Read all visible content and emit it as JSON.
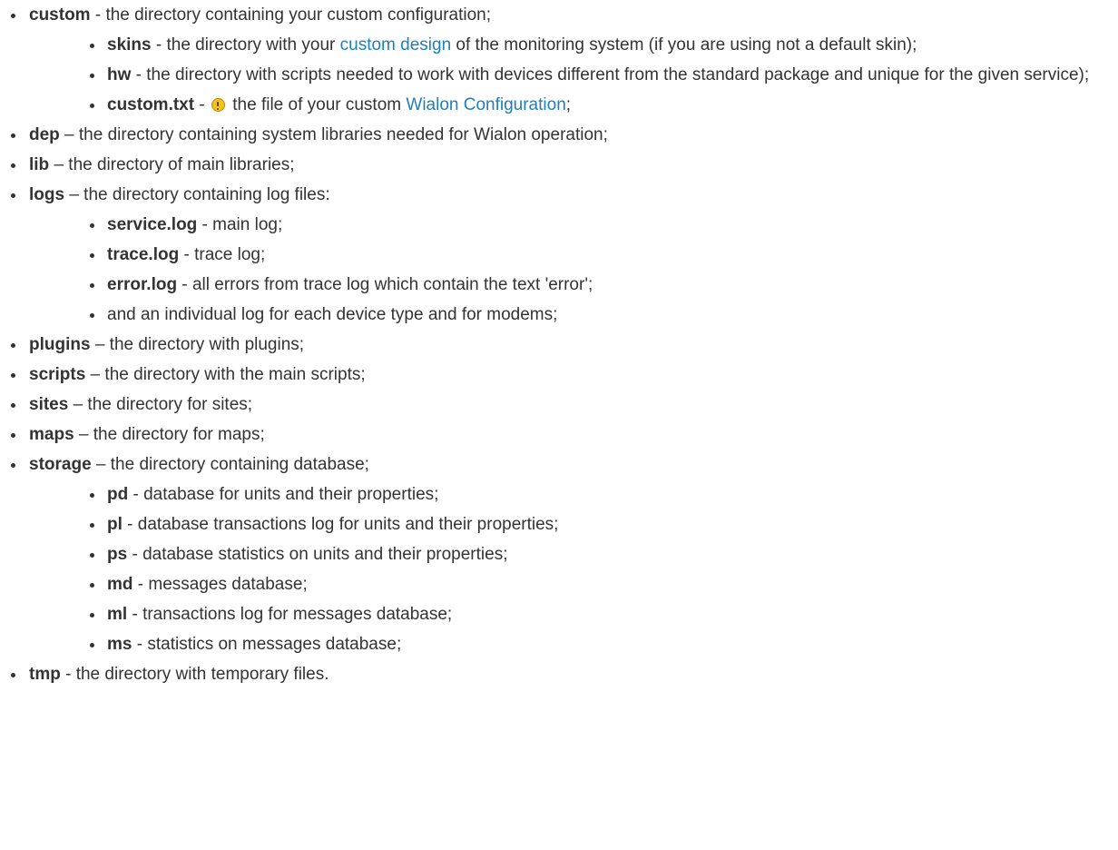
{
  "items": {
    "custom": {
      "name": "custom",
      "desc": " - the directory containing your custom configuration;",
      "children": {
        "skins": {
          "name": "skins",
          "desc_before": " - the directory with your ",
          "link": "custom design",
          "desc_after": " of the monitoring system (if you are using not a default skin);"
        },
        "hw": {
          "name": "hw",
          "desc": " - the directory with scripts needed to work with devices different from the standard package and unique for the given service);"
        },
        "custom_txt": {
          "name": "custom.txt",
          "sep": " - ",
          "desc_before": " the file of your custom ",
          "link": "Wialon Configuration",
          "desc_after": ";"
        }
      }
    },
    "dep": {
      "name": "dep",
      "desc": " – the directory containing system libraries needed for Wialon operation;"
    },
    "lib": {
      "name": "lib",
      "desc": " – the directory of main libraries;"
    },
    "logs": {
      "name": "logs",
      "desc": " – the directory containing log files:",
      "children": {
        "service_log": {
          "name": "service.log",
          "desc": " - main log;"
        },
        "trace_log": {
          "name": "trace.log",
          "desc": " - trace log;"
        },
        "error_log": {
          "name": "error.log",
          "desc": " - all errors from trace log which contain the text 'error';"
        },
        "individual": {
          "text": "and an individual log for each device type and for modems;"
        }
      }
    },
    "plugins": {
      "name": "plugins",
      "desc": " – the directory with plugins;"
    },
    "scripts": {
      "name": "scripts",
      "desc": " – the directory with the main scripts;"
    },
    "sites": {
      "name": "sites",
      "desc": " – the directory for sites;"
    },
    "maps": {
      "name": "maps",
      "desc": " – the directory for maps;"
    },
    "storage": {
      "name": "storage",
      "desc": " – the directory containing database;",
      "children": {
        "pd": {
          "name": "pd",
          "desc": " - database for units and their properties;"
        },
        "pl": {
          "name": "pl",
          "desc": " - database transactions log for units and their properties;"
        },
        "ps": {
          "name": "ps",
          "desc": " - database statistics on units and their properties;"
        },
        "md": {
          "name": "md",
          "desc": " - messages database;"
        },
        "ml": {
          "name": "ml",
          "desc": " - transactions log for messages database;"
        },
        "ms": {
          "name": "ms",
          "desc": " - statistics on messages database;"
        }
      }
    },
    "tmp": {
      "name": "tmp",
      "desc": " - the directory with temporary files."
    }
  },
  "icons": {
    "warning": "warning-icon"
  },
  "colors": {
    "text": "#333333",
    "link": "#1f7fb8",
    "warning_icon": "#f3c21b"
  }
}
